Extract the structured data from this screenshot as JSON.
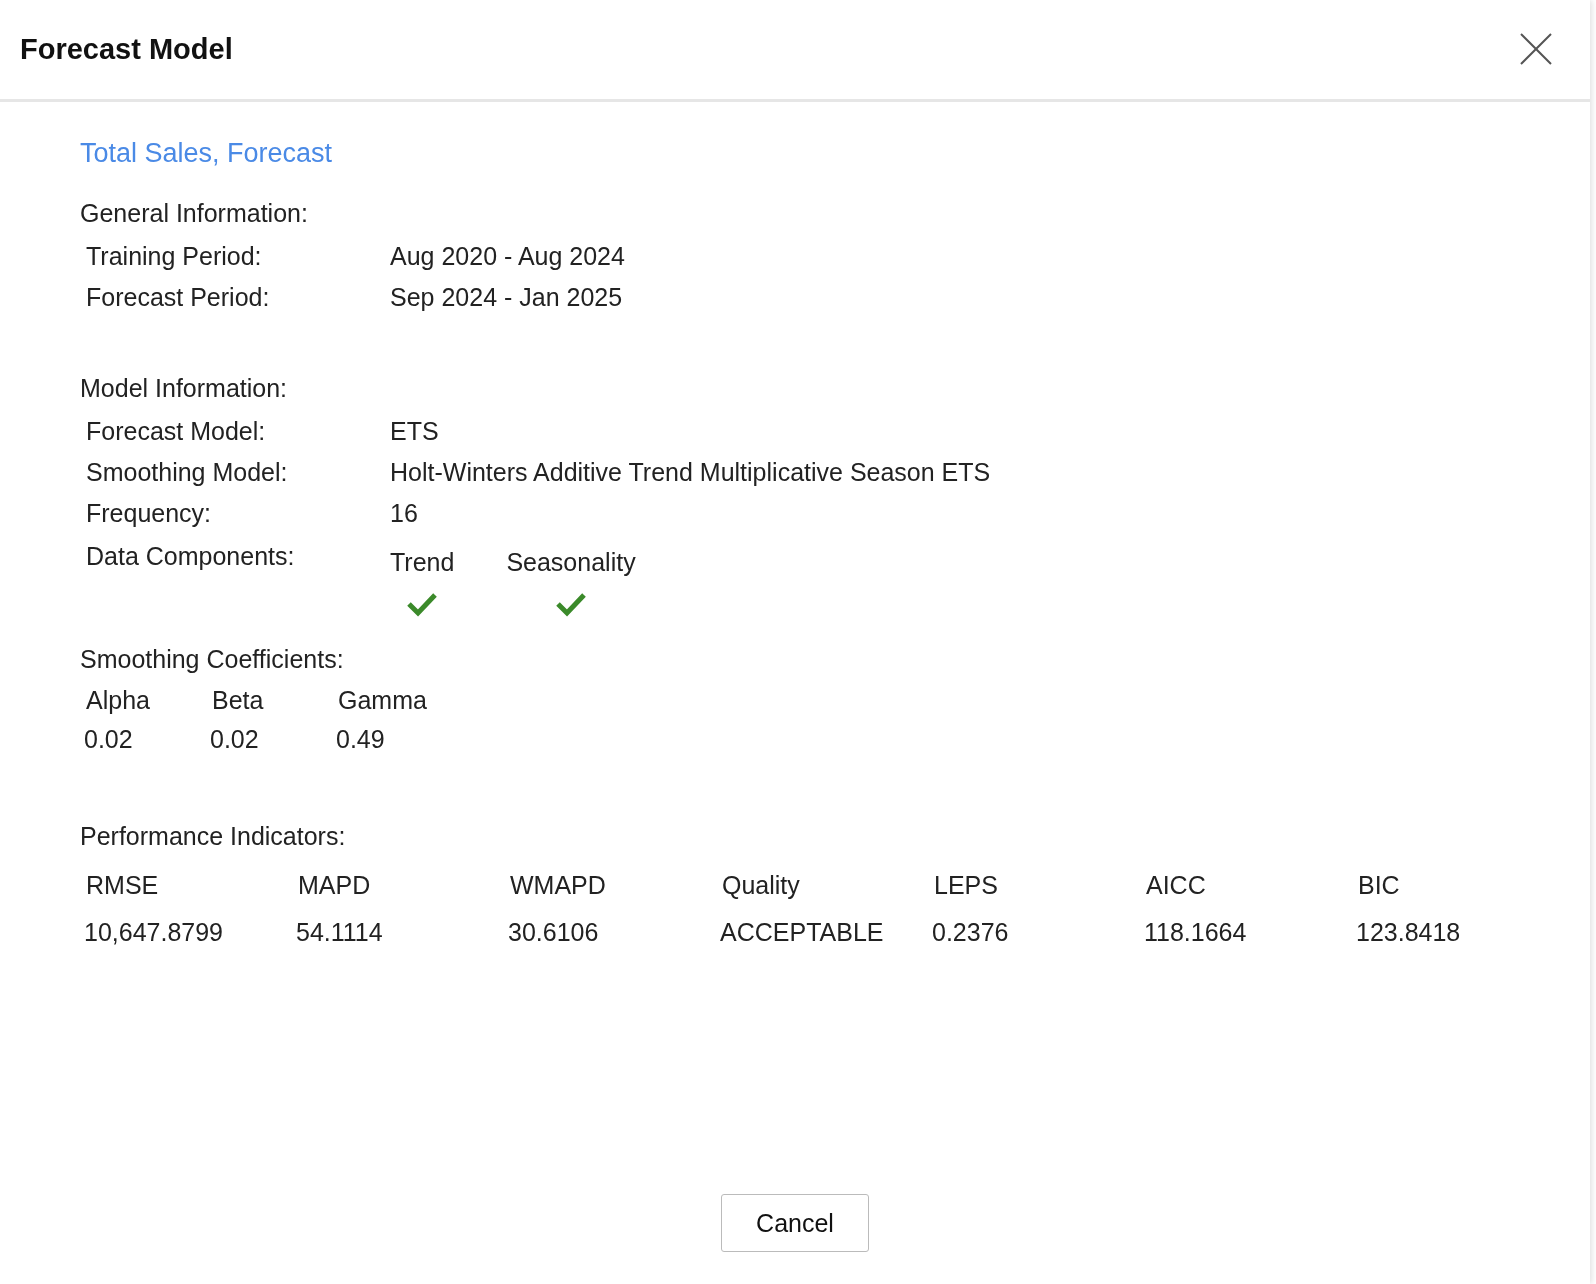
{
  "dialog": {
    "title": "Forecast Model"
  },
  "series_title": "Total Sales, Forecast",
  "general": {
    "heading": "General Information:",
    "rows": [
      {
        "label": "Training Period:",
        "value": "Aug 2020 - Aug 2024"
      },
      {
        "label": "Forecast Period:",
        "value": "Sep 2024 - Jan 2025"
      }
    ]
  },
  "model": {
    "heading": "Model Information:",
    "rows": [
      {
        "label": "Forecast Model:",
        "value": "ETS"
      },
      {
        "label": "Smoothing Model:",
        "value": "Holt-Winters Additive Trend Multiplicative Season ETS"
      },
      {
        "label": "Frequency:",
        "value": "16"
      }
    ],
    "components_label": "Data Components:",
    "components": [
      {
        "name": "Trend",
        "checked": true
      },
      {
        "name": "Seasonality",
        "checked": true
      }
    ]
  },
  "coefficients": {
    "heading": "Smoothing Coefficients:",
    "items": [
      {
        "name": "Alpha",
        "value": "0.02"
      },
      {
        "name": "Beta",
        "value": "0.02"
      },
      {
        "name": "Gamma",
        "value": "0.49"
      }
    ]
  },
  "performance": {
    "heading": "Performance Indicators:",
    "items": [
      {
        "name": "RMSE",
        "value": "10,647.8799"
      },
      {
        "name": "MAPD",
        "value": "54.1114"
      },
      {
        "name": "WMAPD",
        "value": "30.6106"
      },
      {
        "name": "Quality",
        "value": "ACCEPTABLE"
      },
      {
        "name": "LEPS",
        "value": "0.2376"
      },
      {
        "name": "AICC",
        "value": "118.1664"
      },
      {
        "name": "BIC",
        "value": "123.8418"
      }
    ]
  },
  "buttons": [
    {
      "label": "Cancel"
    }
  ]
}
